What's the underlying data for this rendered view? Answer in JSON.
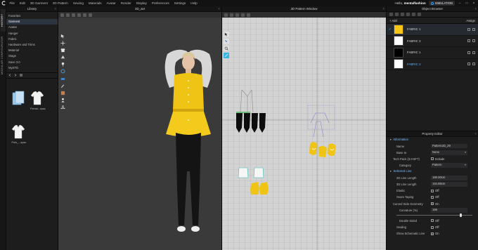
{
  "menubar": {
    "items": [
      "File",
      "Edit",
      "3D Garment",
      "2D Pattern",
      "Sewing",
      "Materials",
      "Avatar",
      "Render",
      "Display",
      "Preferences",
      "Settings",
      "Help"
    ],
    "greeting_prefix": "Hello,",
    "username": "mentalfashion",
    "sim_label": "SIMULATION",
    "window_controls": [
      "minimize",
      "maximize",
      "close"
    ]
  },
  "vtabs": {
    "history": "HISTORY",
    "modular": "MODULAR CONFIGURATOR"
  },
  "library": {
    "title": "Library",
    "items": [
      "Favorites",
      "Garment",
      "Avatar",
      "Hanger",
      "Fabric",
      "Hardware and Trims",
      "Material",
      "Stage",
      "Save 3.0",
      "MySTD"
    ],
    "active_index": 1,
    "thumbnails": [
      {
        "caption": "..",
        "kind": "folder"
      },
      {
        "caption": "Femal...zpac",
        "kind": "garment"
      },
      {
        "caption": "Polo_...zpac",
        "kind": "garment"
      }
    ]
  },
  "view3d": {
    "title": "3D_avt"
  },
  "view2d": {
    "title": "2D Pattern Window"
  },
  "objbrowser": {
    "title": "Object Browser",
    "add_label": "+ Add",
    "assign_label": "Assign",
    "fabrics": [
      {
        "name": "FABRIC 1",
        "color": "#f5c518",
        "selected": true,
        "blue": false
      },
      {
        "name": "FABRIC 2",
        "color": "#ffffff",
        "selected": false,
        "blue": false
      },
      {
        "name": "FABRIC 1",
        "color": "#000000",
        "selected": false,
        "blue": false
      },
      {
        "name": "FABRIC 2",
        "color": "#ffffff",
        "selected": false,
        "blue": true
      }
    ]
  },
  "propedit": {
    "title": "Property Editor",
    "info_section": "Information",
    "name_label": "Name",
    "name_value": "Pattern2D_29",
    "base_label": "Base to",
    "base_value": "None",
    "techpack_label": "Tech Pack (3.0-5FT)",
    "techpack_value": "Include",
    "category_label": "Category",
    "category_value": "Pattern",
    "selected_section": "Selected Line",
    "line_len_label": "2D Line Length",
    "line_len_value": "180.00cm",
    "line3d_label": "3D Line Length",
    "line3d_value": "194.88cm",
    "elastic_label": "Elastic",
    "elastic_value": "Off",
    "seam_label": "Seam Taping",
    "seam_value": "Off",
    "curved_label": "Curved Side Geometry",
    "curved_value": "On",
    "curvature_label": "Curvature (%)",
    "curvature_value": "166",
    "curvature_fraction": 0.84,
    "double_label": "Double Sided",
    "double_value": "Off",
    "sealing_label": "Sealing",
    "sealing_value": "Off",
    "schematic_label": "Show Schematic Line",
    "schematic_value": "On"
  }
}
